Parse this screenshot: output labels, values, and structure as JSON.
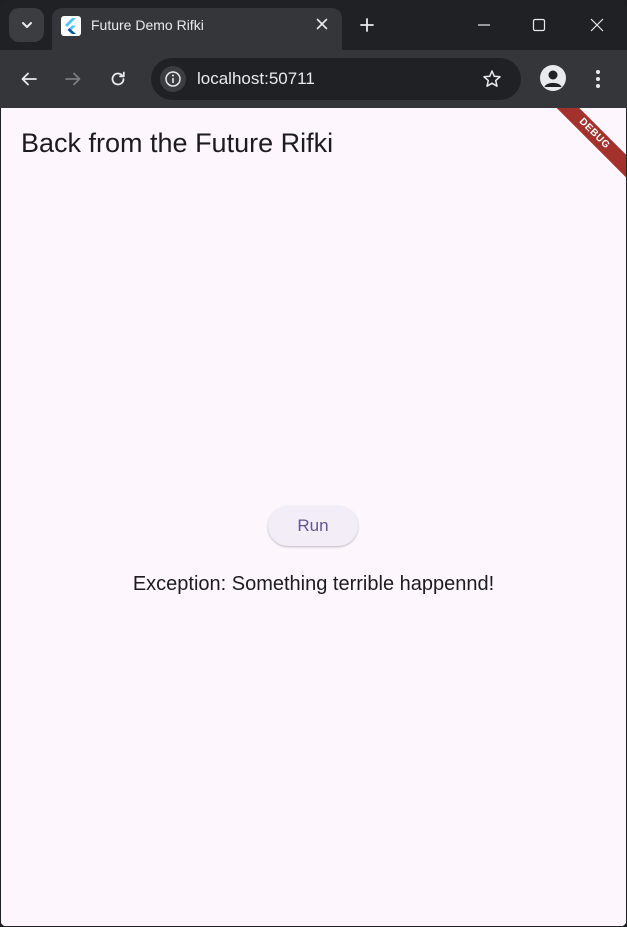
{
  "browser": {
    "tab": {
      "title": "Future Demo Rifki"
    },
    "address_bar": {
      "url": "localhost:50711"
    }
  },
  "app": {
    "appbar_title": "Back from the Future Rifki",
    "debug_banner": "DEBUG",
    "run_button_label": "Run",
    "result_text": "Exception: Something terrible happennd!"
  },
  "icons": {
    "tab_search": "chevron-down-icon",
    "favicon": "flutter-logo-icon",
    "tab_close": "close-icon",
    "new_tab": "plus-icon",
    "minimize": "minimize-icon",
    "maximize": "maximize-icon",
    "close_window": "close-icon",
    "back": "arrow-left-icon",
    "forward": "arrow-right-icon",
    "reload": "reload-icon",
    "site_info": "info-icon",
    "bookmark": "star-icon",
    "profile": "account-icon",
    "menu": "more-vert-icon"
  },
  "colors": {
    "page_background": "#fdf6fd",
    "button_background": "#f3edf7",
    "button_text": "#65558f",
    "debug_banner": "#a3322d",
    "browser_frame": "#202124",
    "toolbar": "#35363a"
  }
}
